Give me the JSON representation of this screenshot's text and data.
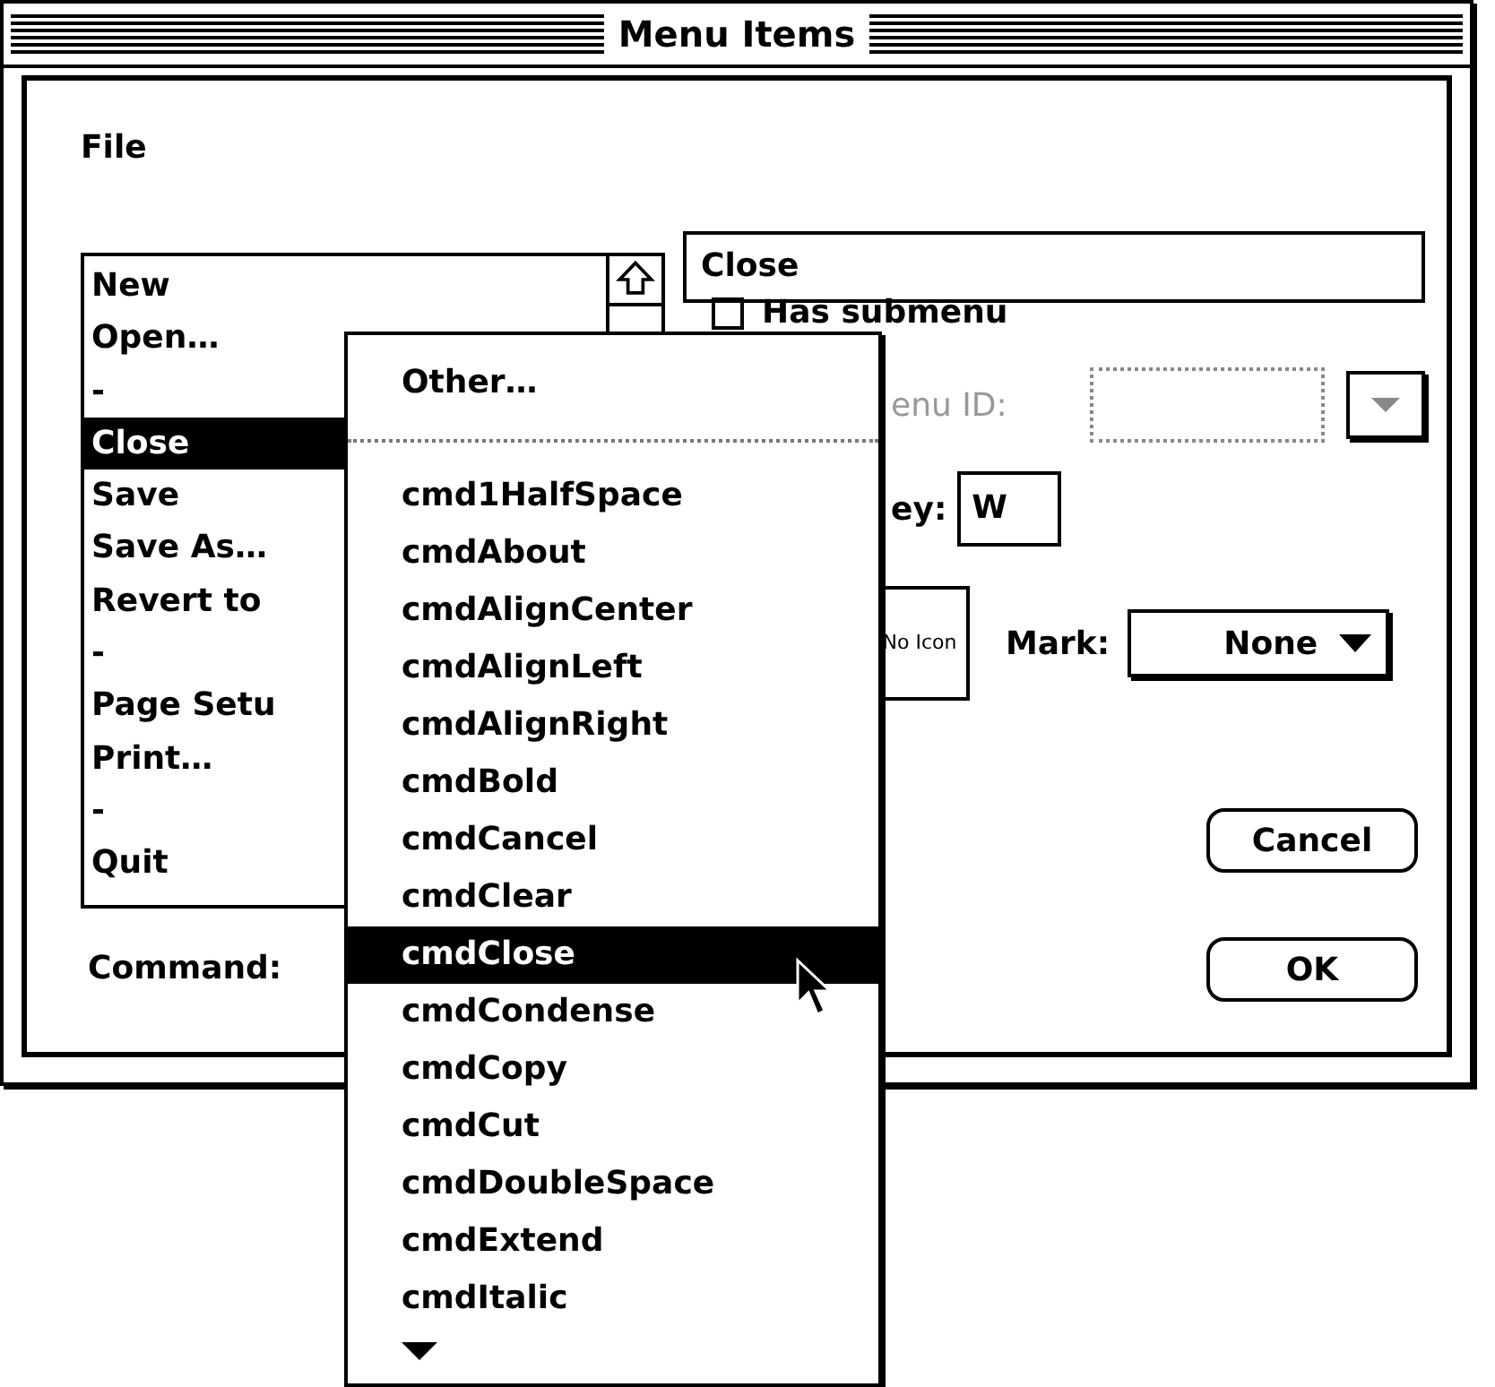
{
  "window": {
    "title": "Menu Items"
  },
  "menu_title": "File",
  "items": [
    {
      "label": "New",
      "selected": false
    },
    {
      "label": "Open…",
      "selected": false
    },
    {
      "label": "-",
      "selected": false
    },
    {
      "label": "Close",
      "selected": true
    },
    {
      "label": "Save",
      "selected": false
    },
    {
      "label": "Save As…",
      "selected": false
    },
    {
      "label": "Revert to",
      "selected": false
    },
    {
      "label": "-",
      "selected": false
    },
    {
      "label": "Page Setu",
      "selected": false
    },
    {
      "label": "Print…",
      "selected": false
    },
    {
      "label": "-",
      "selected": false
    },
    {
      "label": "Quit",
      "selected": false
    }
  ],
  "item_text": {
    "value": "Close"
  },
  "has_submenu": {
    "label": "Has submenu",
    "checked": false
  },
  "submenu_id": {
    "label": "enu ID:",
    "disabled": true
  },
  "key": {
    "label": "ey:",
    "value": "W"
  },
  "icon": {
    "label": "No Icon"
  },
  "mark": {
    "label": "Mark:",
    "value": "None"
  },
  "command_label": "Command:",
  "buttons": [
    {
      "label": "Cancel"
    },
    {
      "label": "OK"
    }
  ],
  "popup": {
    "other": "Other…",
    "items": [
      {
        "label": "cmd1HalfSpace",
        "selected": false
      },
      {
        "label": "cmdAbout",
        "selected": false
      },
      {
        "label": "cmdAlignCenter",
        "selected": false
      },
      {
        "label": "cmdAlignLeft",
        "selected": false
      },
      {
        "label": "cmdAlignRight",
        "selected": false
      },
      {
        "label": "cmdBold",
        "selected": false
      },
      {
        "label": "cmdCancel",
        "selected": false
      },
      {
        "label": "cmdClear",
        "selected": false
      },
      {
        "label": "cmdClose",
        "selected": true
      },
      {
        "label": "cmdCondense",
        "selected": false
      },
      {
        "label": "cmdCopy",
        "selected": false
      },
      {
        "label": "cmdCut",
        "selected": false
      },
      {
        "label": "cmdDoubleSpace",
        "selected": false
      },
      {
        "label": "cmdExtend",
        "selected": false
      },
      {
        "label": "cmdItalic",
        "selected": false
      }
    ]
  }
}
